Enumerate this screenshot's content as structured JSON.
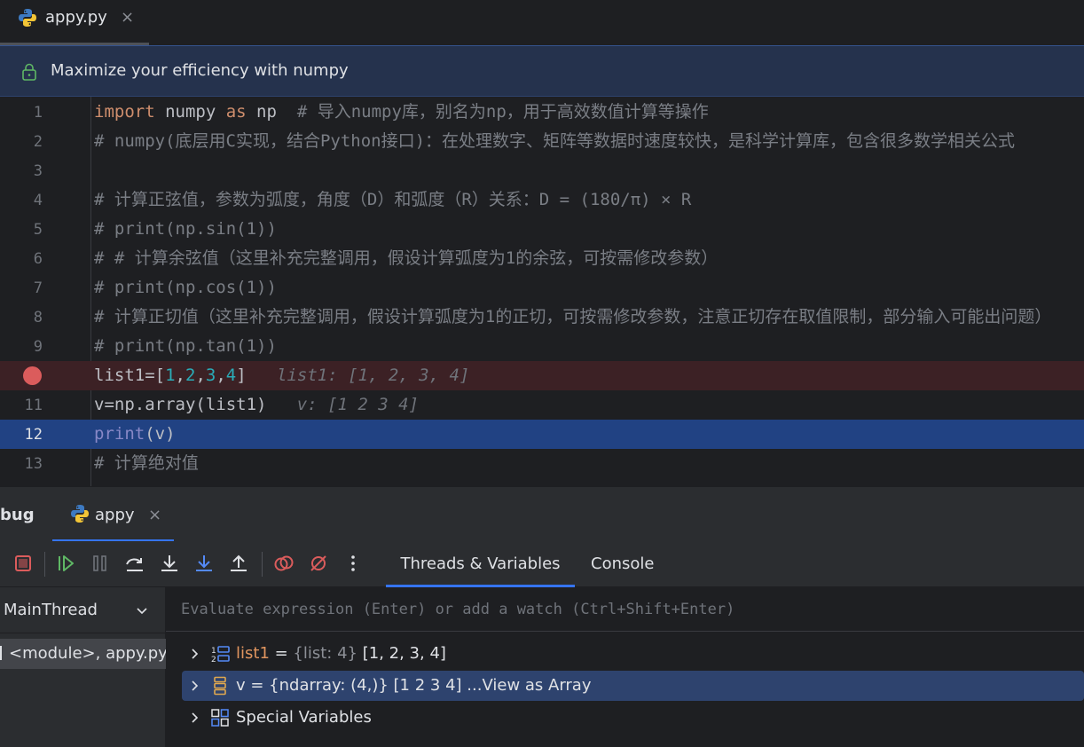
{
  "editor_tab": {
    "file_name": "appy.py",
    "close_glyph": "×",
    "icon": "python-icon"
  },
  "banner": {
    "text": "Maximize your efficiency with numpy",
    "icon": "lock-icon"
  },
  "code_lines": [
    {
      "n": "1",
      "segments": [
        {
          "t": "import",
          "c": "kw"
        },
        {
          "t": " numpy ",
          "c": ""
        },
        {
          "t": "as",
          "c": "kw"
        },
        {
          "t": " np  ",
          "c": ""
        },
        {
          "t": "# 导入numpy库，别名为np，用于高效数值计算等操作",
          "c": "cm"
        }
      ]
    },
    {
      "n": "2",
      "segments": [
        {
          "t": "# numpy(底层用C实现，结合Python接口)：在处理数字、矩阵等数据时速度较快，是科学计算库，包含很多数学相关公式",
          "c": "cm"
        }
      ]
    },
    {
      "n": "3",
      "segments": []
    },
    {
      "n": "4",
      "segments": [
        {
          "t": "# 计算正弦值，参数为弧度，角度（D）和弧度（R）关系：D = (180/π) × R",
          "c": "cm"
        }
      ]
    },
    {
      "n": "5",
      "segments": [
        {
          "t": "# print(np.sin(1))",
          "c": "cm"
        }
      ]
    },
    {
      "n": "6",
      "segments": [
        {
          "t": "# # 计算余弦值（这里补充完整调用，假设计算弧度为1的余弦，可按需修改参数）",
          "c": "cm"
        }
      ]
    },
    {
      "n": "7",
      "segments": [
        {
          "t": "# print(np.cos(1))",
          "c": "cm"
        }
      ]
    },
    {
      "n": "8",
      "segments": [
        {
          "t": "# 计算正切值（这里补充完整调用，假设计算弧度为1的正切，可按需修改参数，注意正切存在取值限制，部分输入可能出问题）",
          "c": "cm"
        }
      ]
    },
    {
      "n": "9",
      "segments": [
        {
          "t": "# print(np.tan(1))",
          "c": "cm"
        }
      ]
    },
    {
      "n": "",
      "breakpoint": true,
      "segments": [
        {
          "t": "list1=[",
          "c": ""
        },
        {
          "t": "1",
          "c": "num"
        },
        {
          "t": ",",
          "c": ""
        },
        {
          "t": "2",
          "c": "num"
        },
        {
          "t": ",",
          "c": ""
        },
        {
          "t": "3",
          "c": "num"
        },
        {
          "t": ",",
          "c": ""
        },
        {
          "t": "4",
          "c": "num"
        },
        {
          "t": "]",
          "c": ""
        },
        {
          "t": "   list1: [1, 2, 3, 4]",
          "c": "inline-hint"
        }
      ]
    },
    {
      "n": "11",
      "segments": [
        {
          "t": "v=np.array(list1)",
          "c": ""
        },
        {
          "t": "   v: [1 2 3 4]",
          "c": "inline-hint"
        }
      ]
    },
    {
      "n": "12",
      "current": true,
      "segments": [
        {
          "t": "print",
          "c": "fn-print"
        },
        {
          "t": "(v)",
          "c": ""
        }
      ]
    },
    {
      "n": "13",
      "segments": [
        {
          "t": "# 计算绝对值",
          "c": "cm"
        }
      ]
    }
  ],
  "debug": {
    "title": "bug",
    "tab_label": "appy",
    "close_glyph": "×",
    "toolbar": [
      "stop-icon",
      "resume-icon",
      "pause-icon",
      "step-over-icon",
      "step-into-icon",
      "step-into-my-code-icon",
      "step-out-icon",
      "view-breakpoints-icon",
      "mute-breakpoints-icon",
      "more-icon"
    ],
    "tabs": {
      "threads": "Threads & Variables",
      "console": "Console"
    },
    "thread": "MainThread",
    "frame": "<module>, appy.py:",
    "eval_placeholder": "Evaluate expression (Enter) or add a watch (Ctrl+Shift+Enter)",
    "variables": [
      {
        "name": "list1",
        "eq": " = ",
        "type": "{list: 4} ",
        "value": "[1, 2, 3, 4]",
        "link": "",
        "icon": "list-icon"
      },
      {
        "name": "v = {ndarray: (4,)} [1 2 3 4] ",
        "eq": "",
        "type": "",
        "value": "",
        "link": "...View as Array",
        "icon": "array-icon",
        "selected": true
      },
      {
        "name": "Special Variables",
        "eq": "",
        "type": "",
        "value": "",
        "link": "",
        "icon": "special-variables-icon"
      }
    ]
  },
  "colors": {
    "accent": "#3574f0",
    "breakpoint": "#db5c5c",
    "current_line": "#214283",
    "keyword": "#cf8e6d",
    "comment": "#7a7e85",
    "number": "#2aacb8"
  }
}
